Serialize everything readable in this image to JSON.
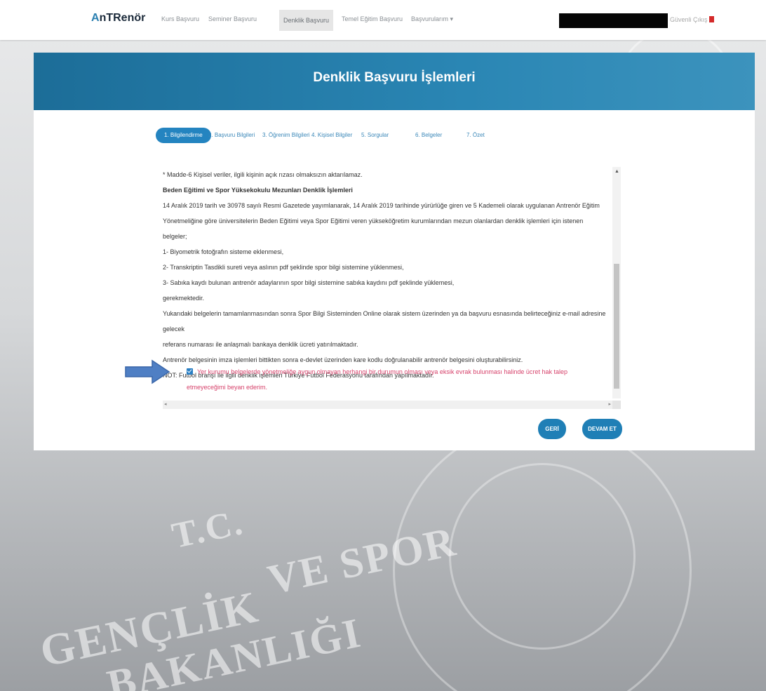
{
  "app": {
    "logo_prefix": "A",
    "logo_text": "nTRenör"
  },
  "nav": {
    "items": [
      {
        "label": "Kurs Başvuru"
      },
      {
        "label": "Seminer Başvuru"
      },
      {
        "label": "Denklik Başvuru"
      },
      {
        "label": "Temel Eğitim Başvuru"
      },
      {
        "label": "Başvurularım ▾"
      }
    ],
    "logout_label": "Güvenli Çıkış"
  },
  "page": {
    "title": "Denklik Başvuru İşlemleri"
  },
  "steps": [
    {
      "label": "1. Bilgilendirme"
    },
    {
      "label": "2. Başvuru Bilgileri"
    },
    {
      "label": "3. Öğrenim Bilgileri"
    },
    {
      "label": "4. Kişisel Bilgiler"
    },
    {
      "label": "5. Sorgular"
    },
    {
      "label": "6. Belgeler"
    },
    {
      "label": "7. Özet"
    }
  ],
  "content": {
    "lines": [
      "* Madde-6 Kişisel veriler, ilgili kişinin açık rızası olmaksızın aktarılamaz.",
      "Beden Eğitimi ve Spor Yüksekokulu Mezunları Denklik İşlemleri",
      "14 Aralık 2019 tarih ve 30978 sayılı Resmi Gazetede yayımlanarak, 14 Aralık 2019 tarihinde yürürlüğe giren ve 5 Kademeli olarak uygulanan Antrenör Eğitim",
      "Yönetmeliğine göre üniversitelerin Beden Eğitimi veya Spor Eğitimi veren yükseköğretim kurumlarından mezun olanlardan denklik işlemleri için istenen belgeler;",
      "1- Biyometrik fotoğrafın sisteme eklenmesi,",
      "2- Transkriptin Tasdikli sureti veya aslının pdf şeklinde spor bilgi sistemine yüklenmesi,",
      "3- Sabıka kaydı bulunan antrenör adaylarının spor bilgi sistemine sabıka kaydını pdf şeklinde yüklemesi,",
      "gerekmektedir.",
      "Yukarıdaki belgelerin tamamlanmasından sonra Spor Bilgi Sisteminden Online olarak sistem üzerinden ya da başvuru esnasında belirteceğiniz e-mail adresine gelecek",
      "referans numarası ile anlaşmalı bankaya denklik ücreti yatırılmaktadır.",
      "Antrenör belgesinin imza işlemleri bittikten sonra e-devlet üzerinden kare kodlu doğrulanabilir antrenör belgesini oluşturabilirsiniz.",
      "NOT: Futbol branşı ile ilgili denklik işlemleri Türkiye Futbol Federasyonu tarafından yapılmaktadır."
    ],
    "consent_line1": "Yer kurumu belgelerde yönetmeliğe aygun olmayan herhangi bir durumun olması veya eksik evrak bulunması halinde ücret hak talep",
    "consent_line2": "etmeyeceğimi beyan ederim."
  },
  "buttons": {
    "back": "GERİ",
    "next": "DEVAM ET"
  },
  "colors": {
    "primary": "#2484c0",
    "consent": "#d6426b",
    "banner": "#1c6d98"
  }
}
